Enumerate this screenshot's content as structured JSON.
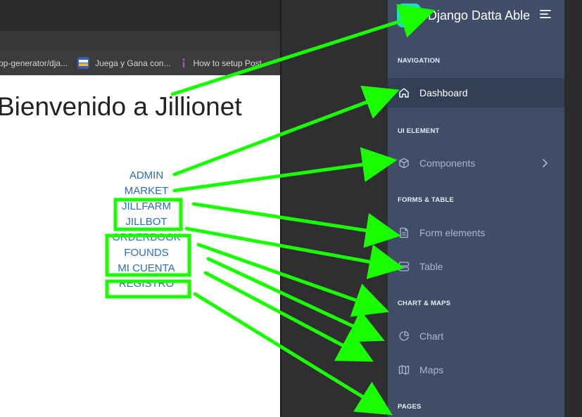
{
  "browser": {
    "bookmarks": [
      {
        "label": "pp-generator/dja...",
        "icon": "github-icon",
        "color": ""
      },
      {
        "label": "Juega y Gana con...",
        "icon": "site-favicon-icon",
        "color": "#3a5da8"
      },
      {
        "label": "How to setup Post",
        "icon": "info-icon",
        "color": "#8e44ad"
      }
    ]
  },
  "page": {
    "title": "Bienvenido a Jillionet",
    "links": [
      "ADMIN",
      "MARKET",
      "JILLFARM",
      "JILLBOT",
      "ORDERBOOK",
      "FOUNDS",
      "MI CUENTA",
      "REGISTRO"
    ]
  },
  "sidebar": {
    "brand": "Django Datta Able",
    "sections": {
      "navigation": "NAVIGATION",
      "ui_element": "UI ELEMENT",
      "forms_table": "FORMS & TABLE",
      "chart_maps": "CHART & MAPS",
      "pages": "PAGES"
    },
    "items": {
      "dashboard": "Dashboard",
      "components": "Components",
      "form_elements": "Form elements",
      "table": "Table",
      "chart": "Chart",
      "maps": "Maps"
    }
  },
  "colors": {
    "sidebar_bg": "#3f4d67",
    "link_blue": "#2a6ebb",
    "annotation_green": "#1aff00"
  }
}
